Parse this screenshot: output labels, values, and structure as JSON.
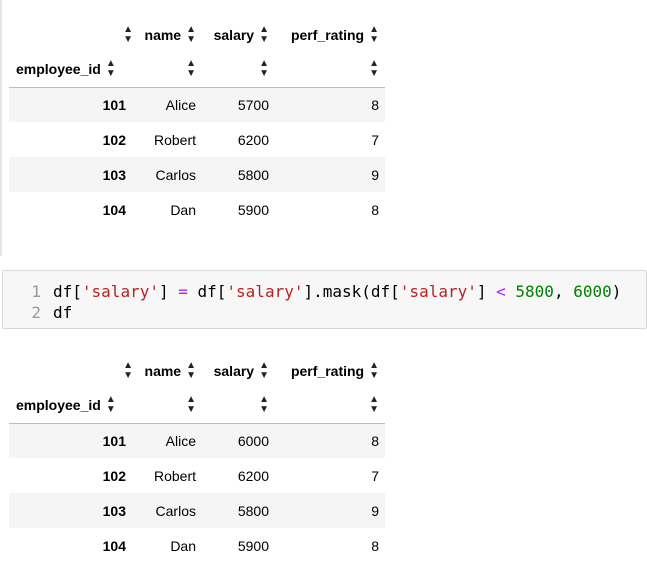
{
  "table1": {
    "columns": [
      "name",
      "salary",
      "perf_rating"
    ],
    "index_name": "employee_id",
    "rows": [
      {
        "id": "101",
        "name": "Alice",
        "salary": "5700",
        "perf_rating": "8"
      },
      {
        "id": "102",
        "name": "Robert",
        "salary": "6200",
        "perf_rating": "7"
      },
      {
        "id": "103",
        "name": "Carlos",
        "salary": "5800",
        "perf_rating": "9"
      },
      {
        "id": "104",
        "name": "Dan",
        "salary": "5900",
        "perf_rating": "8"
      }
    ]
  },
  "code_cell": {
    "line_numbers": [
      "1",
      "2"
    ],
    "line1_tokens": [
      {
        "t": "df[",
        "c": "plain"
      },
      {
        "t": "'salary'",
        "c": "str"
      },
      {
        "t": "] ",
        "c": "plain"
      },
      {
        "t": "=",
        "c": "op"
      },
      {
        "t": " df[",
        "c": "plain"
      },
      {
        "t": "'salary'",
        "c": "str"
      },
      {
        "t": "].mask(df[",
        "c": "plain"
      },
      {
        "t": "'salary'",
        "c": "str"
      },
      {
        "t": "] ",
        "c": "plain"
      },
      {
        "t": "<",
        "c": "op"
      },
      {
        "t": " ",
        "c": "plain"
      },
      {
        "t": "5800",
        "c": "num"
      },
      {
        "t": ", ",
        "c": "plain"
      },
      {
        "t": "6000",
        "c": "num"
      },
      {
        "t": ")",
        "c": "plain"
      }
    ],
    "line2": "df"
  },
  "table2": {
    "columns": [
      "name",
      "salary",
      "perf_rating"
    ],
    "index_name": "employee_id",
    "rows": [
      {
        "id": "101",
        "name": "Alice",
        "salary": "6000",
        "perf_rating": "8"
      },
      {
        "id": "102",
        "name": "Robert",
        "salary": "6200",
        "perf_rating": "7"
      },
      {
        "id": "103",
        "name": "Carlos",
        "salary": "5800",
        "perf_rating": "9"
      },
      {
        "id": "104",
        "name": "Dan",
        "salary": "5900",
        "perf_rating": "8"
      }
    ]
  },
  "sort_icon": "sort-updown-icon",
  "colors": {
    "string": "#ba2121",
    "operator": "#aa22ff",
    "number": "#008000",
    "row_stripe": "#f5f5f5"
  }
}
